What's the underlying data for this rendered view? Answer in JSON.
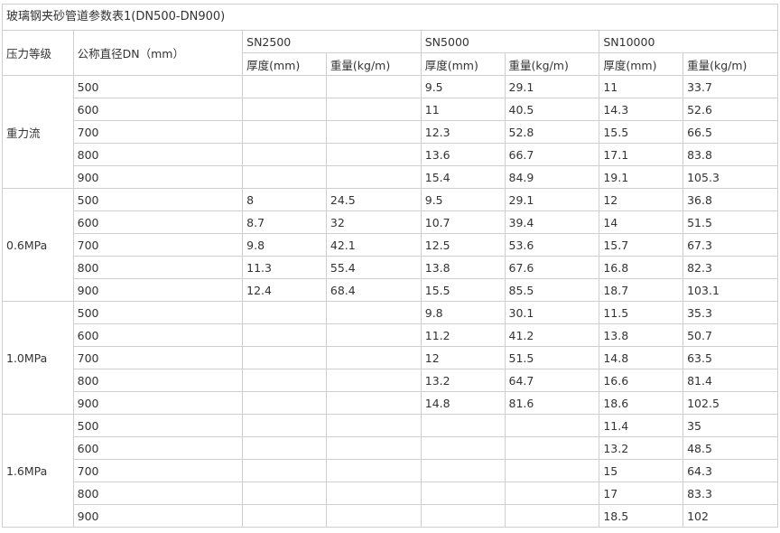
{
  "title": "玻璃钢夹砂管道参数表1(DN500-DN900)",
  "header": {
    "grade": "压力等级",
    "dn": "公称直径DN（mm）",
    "sn": [
      "SN2500",
      "SN5000",
      "SN10000"
    ],
    "thickness": "厚度(mm)",
    "weight": "重量(kg/m)"
  },
  "groups": [
    {
      "grade": "重力流",
      "rows": [
        {
          "dn": "500",
          "sn2500_t": "",
          "sn2500_w": "",
          "sn5000_t": "9.5",
          "sn5000_w": "29.1",
          "sn10000_t": "11",
          "sn10000_w": "33.7"
        },
        {
          "dn": "600",
          "sn2500_t": "",
          "sn2500_w": "",
          "sn5000_t": "11",
          "sn5000_w": "40.5",
          "sn10000_t": "14.3",
          "sn10000_w": "52.6"
        },
        {
          "dn": "700",
          "sn2500_t": "",
          "sn2500_w": "",
          "sn5000_t": "12.3",
          "sn5000_w": "52.8",
          "sn10000_t": "15.5",
          "sn10000_w": "66.5"
        },
        {
          "dn": "800",
          "sn2500_t": "",
          "sn2500_w": "",
          "sn5000_t": "13.6",
          "sn5000_w": "66.7",
          "sn10000_t": "17.1",
          "sn10000_w": "83.8"
        },
        {
          "dn": "900",
          "sn2500_t": "",
          "sn2500_w": "",
          "sn5000_t": "15.4",
          "sn5000_w": "84.9",
          "sn10000_t": "19.1",
          "sn10000_w": "105.3"
        }
      ]
    },
    {
      "grade": "0.6MPa",
      "rows": [
        {
          "dn": "500",
          "sn2500_t": "8",
          "sn2500_w": "24.5",
          "sn5000_t": "9.5",
          "sn5000_w": "29.1",
          "sn10000_t": "12",
          "sn10000_w": "36.8"
        },
        {
          "dn": "600",
          "sn2500_t": "8.7",
          "sn2500_w": "32",
          "sn5000_t": "10.7",
          "sn5000_w": "39.4",
          "sn10000_t": "14",
          "sn10000_w": "51.5"
        },
        {
          "dn": "700",
          "sn2500_t": "9.8",
          "sn2500_w": "42.1",
          "sn5000_t": "12.5",
          "sn5000_w": "53.6",
          "sn10000_t": "15.7",
          "sn10000_w": "67.3"
        },
        {
          "dn": "800",
          "sn2500_t": "11.3",
          "sn2500_w": "55.4",
          "sn5000_t": "13.8",
          "sn5000_w": "67.6",
          "sn10000_t": "16.8",
          "sn10000_w": "82.3"
        },
        {
          "dn": "900",
          "sn2500_t": "12.4",
          "sn2500_w": "68.4",
          "sn5000_t": "15.5",
          "sn5000_w": "85.5",
          "sn10000_t": "18.7",
          "sn10000_w": "103.1"
        }
      ]
    },
    {
      "grade": "1.0MPa",
      "rows": [
        {
          "dn": "500",
          "sn2500_t": "",
          "sn2500_w": "",
          "sn5000_t": "9.8",
          "sn5000_w": "30.1",
          "sn10000_t": "11.5",
          "sn10000_w": "35.3"
        },
        {
          "dn": "600",
          "sn2500_t": "",
          "sn2500_w": "",
          "sn5000_t": "11.2",
          "sn5000_w": "41.2",
          "sn10000_t": "13.8",
          "sn10000_w": "50.7"
        },
        {
          "dn": "700",
          "sn2500_t": "",
          "sn2500_w": "",
          "sn5000_t": "12",
          "sn5000_w": "51.5",
          "sn10000_t": "14.8",
          "sn10000_w": "63.5"
        },
        {
          "dn": "800",
          "sn2500_t": "",
          "sn2500_w": "",
          "sn5000_t": "13.2",
          "sn5000_w": "64.7",
          "sn10000_t": "16.6",
          "sn10000_w": "81.4"
        },
        {
          "dn": "900",
          "sn2500_t": "",
          "sn2500_w": "",
          "sn5000_t": "14.8",
          "sn5000_w": "81.6",
          "sn10000_t": "18.6",
          "sn10000_w": "102.5"
        }
      ]
    },
    {
      "grade": "1.6MPa",
      "rows": [
        {
          "dn": "500",
          "sn2500_t": "",
          "sn2500_w": "",
          "sn5000_t": "",
          "sn5000_w": "",
          "sn10000_t": "11.4",
          "sn10000_w": "35"
        },
        {
          "dn": "600",
          "sn2500_t": "",
          "sn2500_w": "",
          "sn5000_t": "",
          "sn5000_w": "",
          "sn10000_t": "13.2",
          "sn10000_w": "48.5"
        },
        {
          "dn": "700",
          "sn2500_t": "",
          "sn2500_w": "",
          "sn5000_t": "",
          "sn5000_w": "",
          "sn10000_t": "15",
          "sn10000_w": "64.3"
        },
        {
          "dn": "800",
          "sn2500_t": "",
          "sn2500_w": "",
          "sn5000_t": "",
          "sn5000_w": "",
          "sn10000_t": "17",
          "sn10000_w": "83.3"
        },
        {
          "dn": "900",
          "sn2500_t": "",
          "sn2500_w": "",
          "sn5000_t": "",
          "sn5000_w": "",
          "sn10000_t": "18.5",
          "sn10000_w": "102"
        }
      ]
    }
  ]
}
